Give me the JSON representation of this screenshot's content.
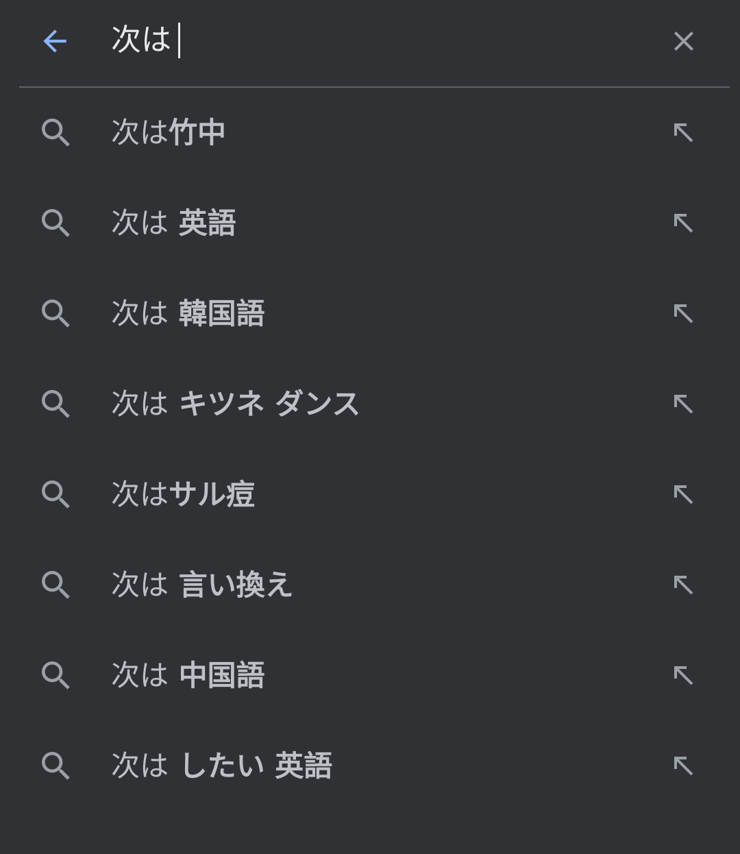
{
  "search": {
    "query": "次は"
  },
  "colors": {
    "background": "#303134",
    "back_arrow": "#8ab4f8",
    "text": "#bdc1c6",
    "icon": "#9aa0a6",
    "divider": "#5f6368"
  },
  "icons": {
    "back": "arrow-left-icon",
    "clear": "close-icon",
    "suggestion": "search-icon",
    "fill": "arrow-up-left-icon"
  },
  "suggestions": [
    {
      "prefix": "次は",
      "completion": "竹中"
    },
    {
      "prefix": "次は",
      "completion": " 英語"
    },
    {
      "prefix": "次は",
      "completion": " 韓国語"
    },
    {
      "prefix": "次は",
      "completion": " キツネ ダンス"
    },
    {
      "prefix": "次は",
      "completion": "サル痘"
    },
    {
      "prefix": "次は",
      "completion": " 言い換え"
    },
    {
      "prefix": "次は",
      "completion": " 中国語"
    },
    {
      "prefix": "次は",
      "completion": " したい 英語"
    }
  ]
}
